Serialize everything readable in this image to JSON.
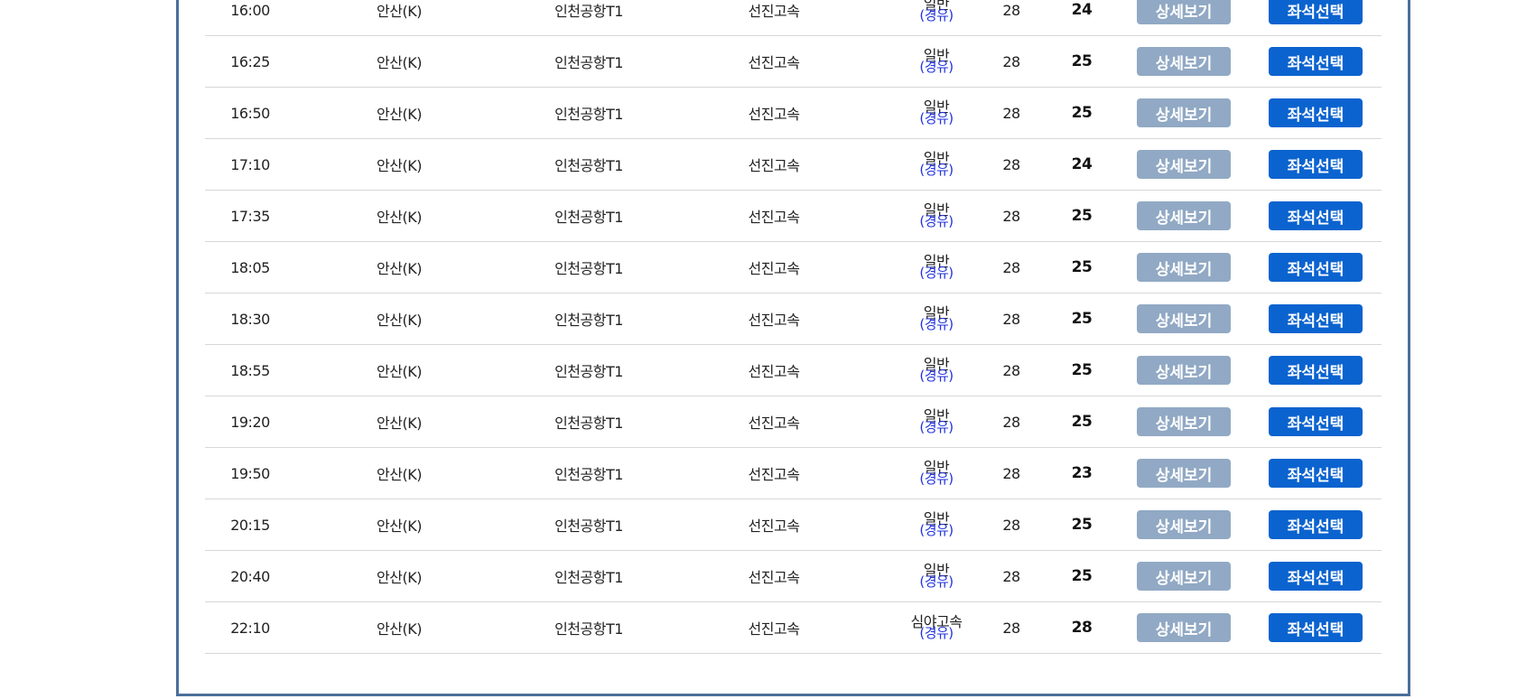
{
  "schedule": {
    "detail_label": "상세보기",
    "seat_label": "좌석선택",
    "rows": [
      {
        "time": "16:00",
        "from": "안산(K)",
        "to": "인천공항T1",
        "company": "선진고속",
        "grade": "일반",
        "via": "(경유)",
        "total": "28",
        "remaining": "24"
      },
      {
        "time": "16:25",
        "from": "안산(K)",
        "to": "인천공항T1",
        "company": "선진고속",
        "grade": "일반",
        "via": "(경유)",
        "total": "28",
        "remaining": "25"
      },
      {
        "time": "16:50",
        "from": "안산(K)",
        "to": "인천공항T1",
        "company": "선진고속",
        "grade": "일반",
        "via": "(경유)",
        "total": "28",
        "remaining": "25"
      },
      {
        "time": "17:10",
        "from": "안산(K)",
        "to": "인천공항T1",
        "company": "선진고속",
        "grade": "일반",
        "via": "(경유)",
        "total": "28",
        "remaining": "24"
      },
      {
        "time": "17:35",
        "from": "안산(K)",
        "to": "인천공항T1",
        "company": "선진고속",
        "grade": "일반",
        "via": "(경유)",
        "total": "28",
        "remaining": "25"
      },
      {
        "time": "18:05",
        "from": "안산(K)",
        "to": "인천공항T1",
        "company": "선진고속",
        "grade": "일반",
        "via": "(경유)",
        "total": "28",
        "remaining": "25"
      },
      {
        "time": "18:30",
        "from": "안산(K)",
        "to": "인천공항T1",
        "company": "선진고속",
        "grade": "일반",
        "via": "(경유)",
        "total": "28",
        "remaining": "25"
      },
      {
        "time": "18:55",
        "from": "안산(K)",
        "to": "인천공항T1",
        "company": "선진고속",
        "grade": "일반",
        "via": "(경유)",
        "total": "28",
        "remaining": "25"
      },
      {
        "time": "19:20",
        "from": "안산(K)",
        "to": "인천공항T1",
        "company": "선진고속",
        "grade": "일반",
        "via": "(경유)",
        "total": "28",
        "remaining": "25"
      },
      {
        "time": "19:50",
        "from": "안산(K)",
        "to": "인천공항T1",
        "company": "선진고속",
        "grade": "일반",
        "via": "(경유)",
        "total": "28",
        "remaining": "23"
      },
      {
        "time": "20:15",
        "from": "안산(K)",
        "to": "인천공항T1",
        "company": "선진고속",
        "grade": "일반",
        "via": "(경유)",
        "total": "28",
        "remaining": "25"
      },
      {
        "time": "20:40",
        "from": "안산(K)",
        "to": "인천공항T1",
        "company": "선진고속",
        "grade": "일반",
        "via": "(경유)",
        "total": "28",
        "remaining": "25"
      },
      {
        "time": "22:10",
        "from": "안산(K)",
        "to": "인천공항T1",
        "company": "선진고속",
        "grade": "심야고속",
        "via": "(경유)",
        "total": "28",
        "remaining": "28"
      }
    ]
  },
  "colors": {
    "frame_border": "#4a6f9b",
    "detail_button": "#91a9c4",
    "seat_button": "#0b63cf",
    "via_text": "#2233dd"
  }
}
